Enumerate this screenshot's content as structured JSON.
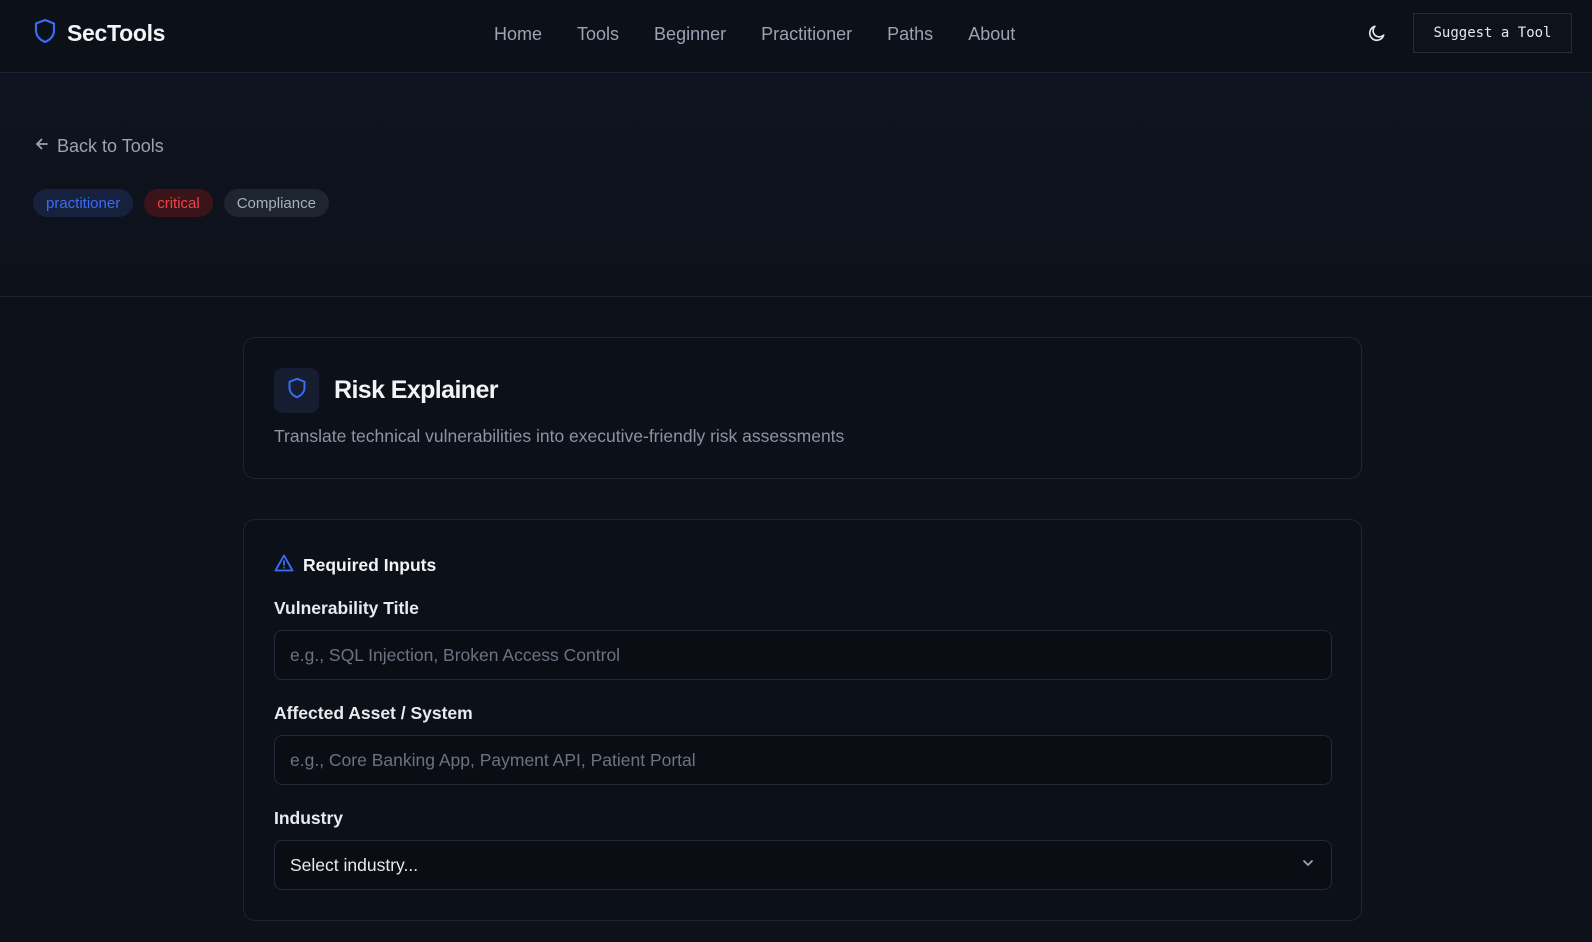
{
  "header": {
    "brand": "SecTools",
    "nav": [
      "Home",
      "Tools",
      "Beginner",
      "Practitioner",
      "Paths",
      "About"
    ],
    "suggest_label": "Suggest a Tool",
    "accent_color": "#3b6cf6"
  },
  "hero": {
    "back_label": "Back to Tools",
    "tags": {
      "level": "practitioner",
      "severity": "critical",
      "category": "Compliance"
    }
  },
  "tool": {
    "title": "Risk Explainer",
    "description": "Translate technical vulnerabilities into executive-friendly risk assessments"
  },
  "form": {
    "section_title": "Required Inputs",
    "vuln_label": "Vulnerability Title",
    "vuln_placeholder": "e.g., SQL Injection, Broken Access Control",
    "vuln_value": "",
    "asset_label": "Affected Asset / System",
    "asset_placeholder": "e.g., Core Banking App, Payment API, Patient Portal",
    "asset_value": "",
    "industry_label": "Industry",
    "industry_selected": "Select industry..."
  }
}
